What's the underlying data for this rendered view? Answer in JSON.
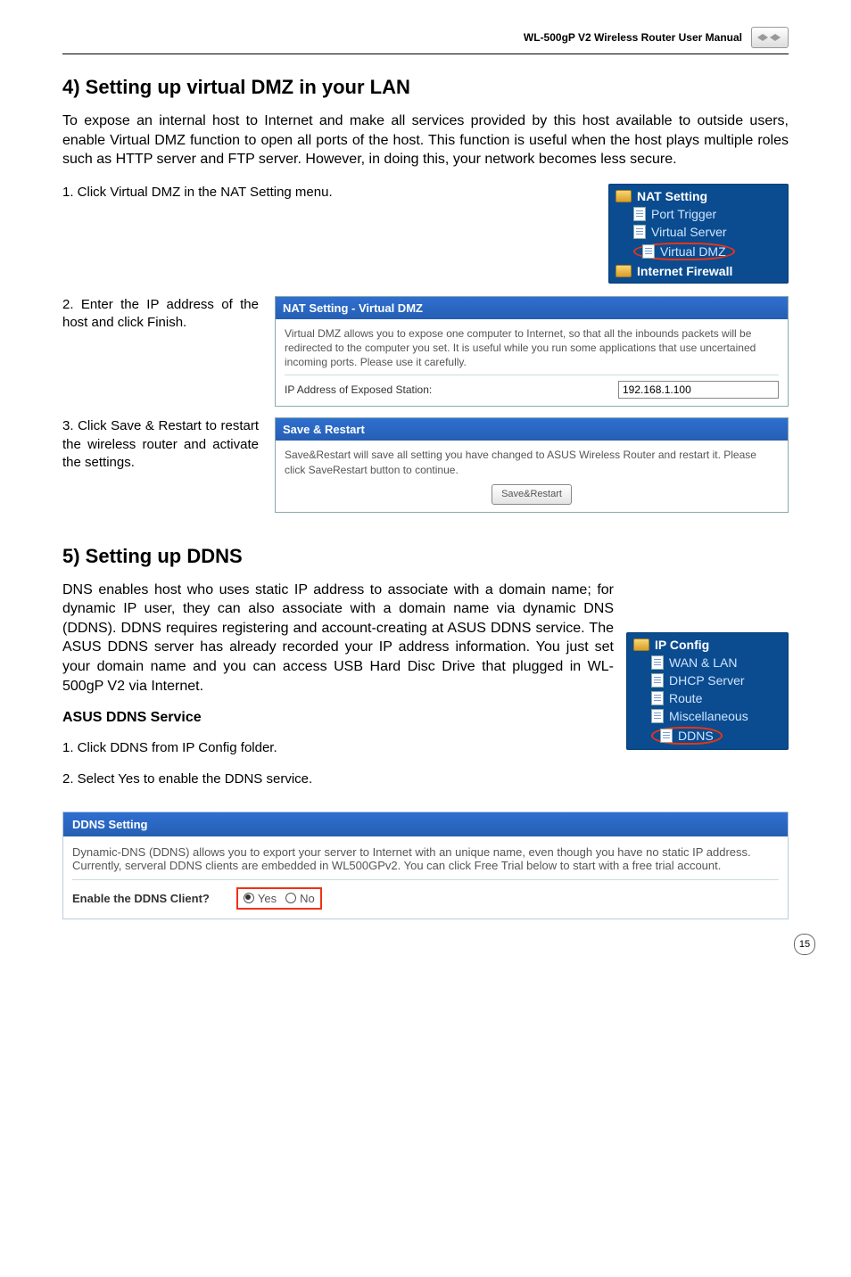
{
  "header": {
    "title": "WL-500gP V2 Wireless Router User Manual"
  },
  "section1": {
    "title": "4) Setting up virtual DMZ in your LAN",
    "intro": "To expose an internal host to Internet and make all services provided by this host available to outside users, enable Virtual DMZ function to open all ports of the host. This function is useful when the host plays multiple roles such as HTTP server and FTP server. However, in doing this, your network becomes less secure.",
    "step1": "1.  Click Virtual DMZ in the NAT Setting menu.",
    "step2": "2.  Enter the IP address of the host and click Finish.",
    "step3": "3.  Click Save & Restart to restart the wireless router and activate the settings."
  },
  "nav1": {
    "folder": "NAT Setting",
    "items": [
      "Port Trigger",
      "Virtual Server",
      "Virtual DMZ"
    ],
    "folder2": "Internet Firewall"
  },
  "panel_dmz": {
    "title": "NAT Setting - Virtual DMZ",
    "desc": "Virtual DMZ allows you to expose one computer to Internet, so that all the inbounds packets will be redirected to the computer you set. It is useful while you run some applications that use uncertained incoming ports. Please use it carefully.",
    "field_label": "IP Address of Exposed Station:",
    "field_value": "192.168.1.100"
  },
  "panel_save": {
    "title": "Save & Restart",
    "desc": "Save&Restart will save all setting you have changed to ASUS Wireless Router and restart it. Please click SaveRestart button to continue.",
    "button": "Save&Restart"
  },
  "section2": {
    "title": "5) Setting up DDNS",
    "intro": "DNS enables host who uses static IP address to associate with a domain name; for dynamic IP user, they can also associate with a domain name via dynamic DNS (DDNS). DDNS requires registering and account-creating at ASUS DDNS service. The ASUS DDNS server has already recorded your IP address information. You just set your domain name and you can access USB Hard Disc Drive that plugged in WL-500gP V2 via Internet.",
    "sub": "ASUS DDNS Service",
    "step1": "1.  Click DDNS from IP Config folder.",
    "step2": "2.  Select Yes to enable the DDNS service."
  },
  "nav2": {
    "folder": "IP Config",
    "items": [
      "WAN & LAN",
      "DHCP Server",
      "Route",
      "Miscellaneous",
      "DDNS"
    ]
  },
  "panel_ddns": {
    "title": "DDNS Setting",
    "desc": "Dynamic-DNS (DDNS) allows you to export your server to Internet with an unique name, even though you have no static IP address. Currently, serveral DDNS clients are embedded in WL500GPv2. You can click Free Trial below to start with a free trial account.",
    "field_label": "Enable the DDNS Client?",
    "yes": "Yes",
    "no": "No"
  },
  "page_number": "15"
}
